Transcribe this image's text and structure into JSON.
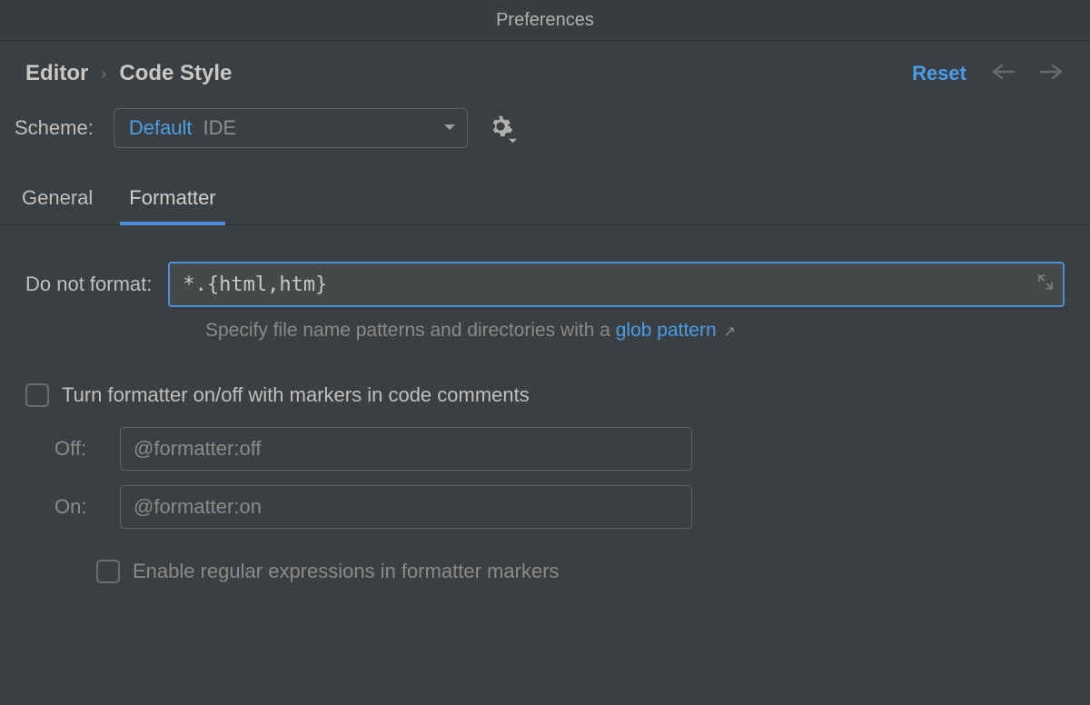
{
  "window": {
    "title": "Preferences"
  },
  "breadcrumb": {
    "parent": "Editor",
    "current": "Code Style"
  },
  "header": {
    "reset": "Reset"
  },
  "scheme": {
    "label": "Scheme:",
    "selected": "Default",
    "badge": "IDE"
  },
  "tabs": {
    "general": "General",
    "formatter": "Formatter"
  },
  "form": {
    "doNotFormat": {
      "label": "Do not format:",
      "value": "*.{html,htm}"
    },
    "hint": {
      "prefix": "Specify file name patterns and directories with a ",
      "linkText": "glob pattern"
    },
    "markersToggle": {
      "label": "Turn formatter on/off with markers in code comments"
    },
    "off": {
      "label": "Off:",
      "value": "@formatter:off"
    },
    "on": {
      "label": "On:",
      "value": "@formatter:on"
    },
    "regex": {
      "label": "Enable regular expressions in formatter markers"
    }
  }
}
